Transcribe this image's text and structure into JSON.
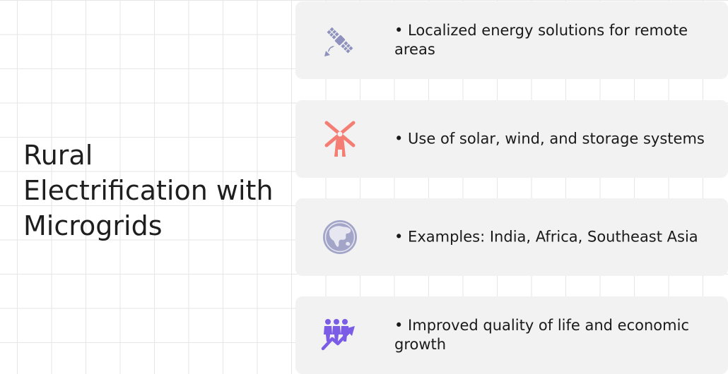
{
  "slide": {
    "title": "Rural Electrification with Microgrids"
  },
  "cards": [
    {
      "icon": "satellite-icon",
      "text": "• Localized energy solutions for remote areas",
      "icon_color": "#8e92bd"
    },
    {
      "icon": "windmill-icon",
      "text": "• Use of solar, wind, and storage systems",
      "icon_color": "#f47d74"
    },
    {
      "icon": "globe-asia-icon",
      "text": "• Examples: India, Africa, Southeast Asia",
      "icon_color": "#a3a5c8"
    },
    {
      "icon": "people-growth-icon",
      "text": "• Improved quality of life and economic growth",
      "icon_color": "#7b5ce6"
    }
  ],
  "colors": {
    "card_background": "#f2f2f2",
    "grid_line": "#e6e6e6",
    "text": "#1a1a1a"
  }
}
